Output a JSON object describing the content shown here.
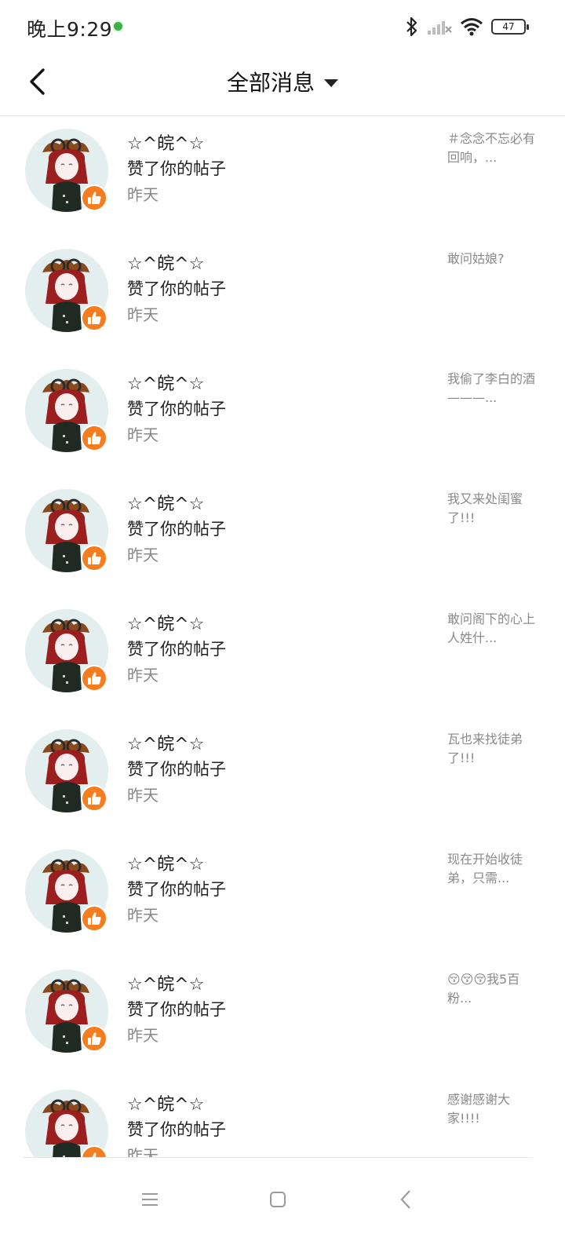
{
  "status_bar": {
    "time": "晚上9:29",
    "notification_icon": "wechat-icon",
    "icons": [
      "bluetooth-icon",
      "signal-icon",
      "wifi-icon",
      "battery-icon"
    ],
    "battery": "47"
  },
  "header": {
    "title": "全部消息",
    "back_icon": "back-arrow-icon",
    "dropdown_icon": "caret-down-icon"
  },
  "messages": [
    {
      "name": "☆^皖^☆",
      "action": "赞了你的帖子",
      "time": "昨天",
      "preview": "＃念念不忘必有回响，..."
    },
    {
      "name": "☆^皖^☆",
      "action": "赞了你的帖子",
      "time": "昨天",
      "preview": "敢问姑娘?"
    },
    {
      "name": "☆^皖^☆",
      "action": "赞了你的帖子",
      "time": "昨天",
      "preview": "我偷了李白的酒———..."
    },
    {
      "name": "☆^皖^☆",
      "action": "赞了你的帖子",
      "time": "昨天",
      "preview": "我又来处闺蜜了!!!"
    },
    {
      "name": "☆^皖^☆",
      "action": "赞了你的帖子",
      "time": "昨天",
      "preview": "敢问阁下的心上人姓什..."
    },
    {
      "name": "☆^皖^☆",
      "action": "赞了你的帖子",
      "time": "昨天",
      "preview": "瓦也来找徒弟了!!!"
    },
    {
      "name": "☆^皖^☆",
      "action": "赞了你的帖子",
      "time": "昨天",
      "preview": "现在开始收徒弟，只需..."
    },
    {
      "name": "☆^皖^☆",
      "action": "赞了你的帖子",
      "time": "昨天",
      "preview": "😚😚😚我5百粉..."
    },
    {
      "name": "☆^皖^☆",
      "action": "赞了你的帖子",
      "time": "昨天",
      "preview": "感谢感谢大家!!!!"
    }
  ],
  "nav_bar": {
    "icons": [
      "menu-icon",
      "home-icon",
      "back-icon"
    ]
  },
  "colors": {
    "like_badge": "#f57c1f",
    "avatar_bg": "#e3eeee",
    "text_primary": "#222222",
    "text_secondary": "#888888"
  }
}
